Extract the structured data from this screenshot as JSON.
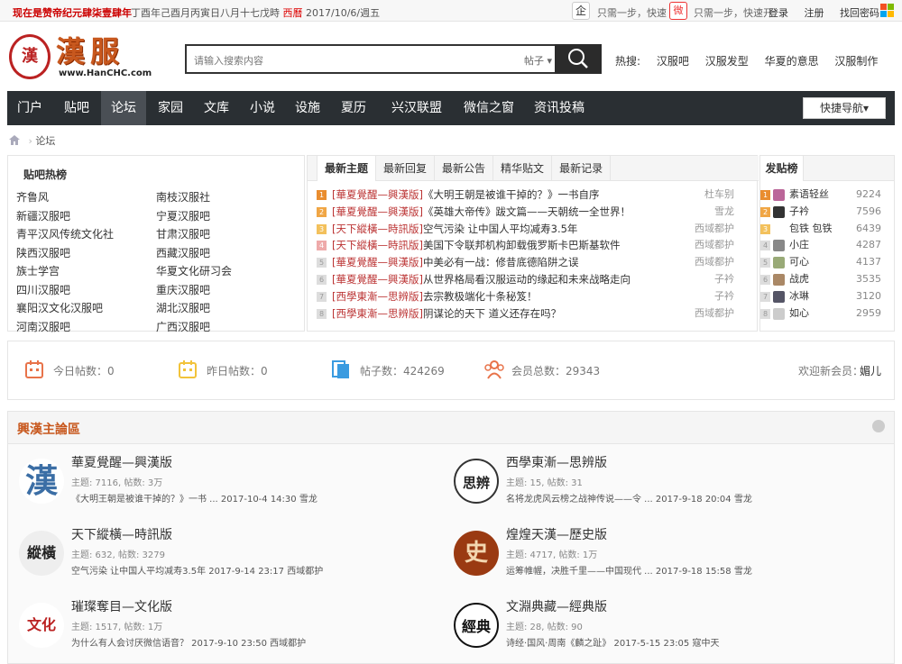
{
  "topbar": {
    "left": "现在是赞帝纪元肆柒壹肆年",
    "calendar": "丁酉年己酉月丙寅日八月十七戊時",
    "calendar_red": "西曆",
    "date": "2017/10/6/週五",
    "qq_icon": "企",
    "qq_text": "只需一步，快速",
    "weibo_icon": "微",
    "weibo_text": "只需一步，快速开",
    "links": [
      "登录",
      "注册",
      "找回密码"
    ]
  },
  "logo": {
    "seal": "漢",
    "title": "漢服",
    "url": "www.HanCHC.com"
  },
  "search": {
    "placeholder": "请输入搜索内容",
    "scope": "帖子 ▾"
  },
  "hot": {
    "label": "热搜:",
    "items": [
      "汉服吧",
      "汉服发型",
      "华夏的意思",
      "汉服制作"
    ]
  },
  "nav": {
    "items": [
      "门户",
      "贴吧",
      "论坛",
      "家园",
      "文库",
      "小说",
      "设施",
      "夏历",
      "兴汉联盟",
      "微信之窗",
      "资讯投稿"
    ],
    "active": "论坛",
    "quick": "快捷导航▾"
  },
  "breadcrumb": "论坛",
  "hotbars": {
    "title": "贴吧热榜",
    "left": [
      "齐鲁风",
      "新疆汉服吧",
      "青平汉风传统文化社",
      "陕西汉服吧",
      "族士学宫",
      "四川汉服吧",
      "襄阳汉文化汉服吧",
      "河南汉服吧"
    ],
    "right": [
      "南枝汉服社",
      "宁夏汉服吧",
      "甘肃汉服吧",
      "西藏汉服吧",
      "华夏文化研习会",
      "重庆汉服吧",
      "湖北汉服吧",
      "广西汉服吧"
    ]
  },
  "latest": {
    "tabs": [
      "最新主题",
      "最新回复",
      "最新公告",
      "精华贴文",
      "最新记录"
    ],
    "threads": [
      {
        "n": "1",
        "tag": "[華夏覺醒—興漢版]",
        "title": "《大明王朝是被谁干掉的？》一书自序",
        "author": "杜车别"
      },
      {
        "n": "2",
        "tag": "[華夏覺醒—興漢版]",
        "title": "《英雄大帝传》跋文篇——天朝统一全世界！",
        "author": "雪龙"
      },
      {
        "n": "3",
        "tag": "[天下縱橫—時訊版]",
        "title": "空气污染 让中国人平均减寿3.5年",
        "author": "西域都护"
      },
      {
        "n": "4",
        "tag": "[天下縱橫—時訊版]",
        "title": "美国下令联邦机构卸载俄罗斯卡巴斯基软件",
        "author": "西域都护"
      },
      {
        "n": "5",
        "tag": "[華夏覺醒—興漢版]",
        "title": "中美必有一战：修昔底德陷阱之误",
        "author": "西域都护"
      },
      {
        "n": "6",
        "tag": "[華夏覺醒—興漢版]",
        "title": "从世界格局看汉服运动的缘起和未来战略走向",
        "author": "子衿"
      },
      {
        "n": "7",
        "tag": "[西學東漸—思辨版]",
        "title": "去宗教极端化十条秘笈！",
        "author": "子衿"
      },
      {
        "n": "8",
        "tag": "[西學東漸—思辨版]",
        "title": "阴谋论的天下 道义还存在吗？",
        "author": "西域都护"
      }
    ]
  },
  "rank": {
    "title": "发贴榜",
    "rows": [
      {
        "n": "1",
        "name": "素语轻丝",
        "count": "9224"
      },
      {
        "n": "2",
        "name": "子衿",
        "count": "7596"
      },
      {
        "n": "3",
        "name": "包铁 包铁",
        "count": "6439"
      },
      {
        "n": "4",
        "name": "小庄",
        "count": "4287"
      },
      {
        "n": "5",
        "name": "可心",
        "count": "4137"
      },
      {
        "n": "6",
        "name": "战虎",
        "count": "3535"
      },
      {
        "n": "7",
        "name": "冰琳",
        "count": "3120"
      },
      {
        "n": "8",
        "name": "如心",
        "count": "2959"
      }
    ]
  },
  "stats": {
    "today": "今日帖数：0",
    "yesterday": "昨日帖数：0",
    "posts": "帖子数：424269",
    "members": "会员总数：29343",
    "welcome": "欢迎新会员：",
    "newest": "媚儿"
  },
  "forum": {
    "title": "興漢主論區",
    "boards": [
      {
        "icon": "漢",
        "name": "華夏覺醒—興漢版",
        "meta": "主题: 7116, 帖数: 3万",
        "last": "《大明王朝是被谁干掉的？》一书 ... 2017-10-4 14:30 雪龙"
      },
      {
        "icon": "思辨",
        "name": "西學東漸—思辨版",
        "meta": "主题: 15, 帖数: 31",
        "last": "名将龙虎风云榜之战神传说——令 ... 2017-9-18 20:04 雪龙"
      },
      {
        "icon": "縱橫",
        "name": "天下縱橫—時訊版",
        "meta": "主题: 632, 帖数: 3279",
        "last": "空气污染 让中国人平均减寿3.5年 2017-9-14 23:17 西域都护"
      },
      {
        "icon": "史",
        "name": "煌煌天漢—歷史版",
        "meta": "主题: 4717, 帖数: 1万",
        "last": "运筹帷幄，决胜千里——中国现代 ... 2017-9-18 15:58 雪龙"
      },
      {
        "icon": "文化",
        "name": "璀璨奪目—文化版",
        "meta": "主题: 1517, 帖数: 1万",
        "last": "为什么有人会讨厌微信语音？ 2017-9-10 23:50 西域都护"
      },
      {
        "icon": "經典",
        "name": "文淵典藏—經典版",
        "meta": "主题: 28, 帖数: 90",
        "last": "诗经·国风·周南《麟之趾》 2017-5-15 23:05 寇中天"
      }
    ]
  }
}
